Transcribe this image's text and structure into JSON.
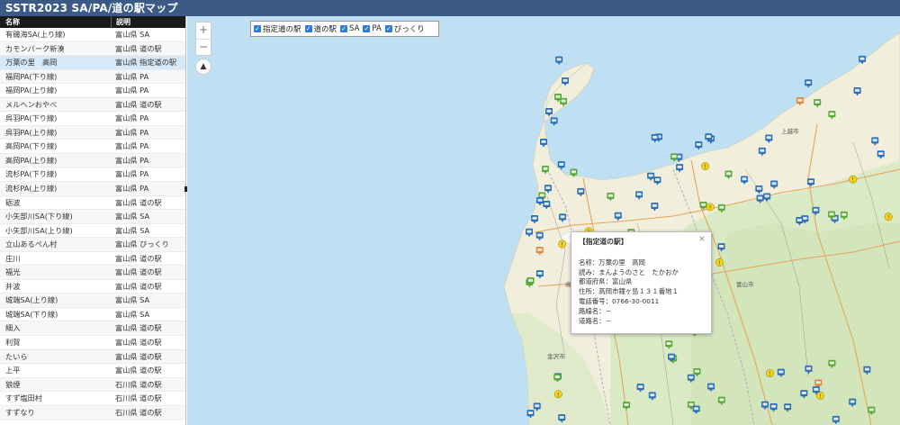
{
  "app": {
    "title": "SSTR2023  SA/PA/道の駅マップ"
  },
  "list": {
    "headers": [
      "名称",
      "説明"
    ],
    "selected_index": 2,
    "rows": [
      {
        "name": "有磯海SA(上り線)",
        "desc": "富山県 SA"
      },
      {
        "name": "カモンパーク新湊",
        "desc": "富山県 道の駅"
      },
      {
        "name": "万葉の里　高岡",
        "desc": "富山県 指定道の駅"
      },
      {
        "name": "福岡PA(下り線)",
        "desc": "富山県 PA"
      },
      {
        "name": "福岡PA(上り線)",
        "desc": "富山県 PA"
      },
      {
        "name": "メルヘンおやべ",
        "desc": "富山県 道の駅"
      },
      {
        "name": "呉羽PA(下り線)",
        "desc": "富山県 PA"
      },
      {
        "name": "呉羽PA(上り線)",
        "desc": "富山県 PA"
      },
      {
        "name": "高岡PA(下り線)",
        "desc": "富山県 PA"
      },
      {
        "name": "高岡PA(上り線)",
        "desc": "富山県 PA"
      },
      {
        "name": "流杉PA(下り線)",
        "desc": "富山県 PA"
      },
      {
        "name": "流杉PA(上り線)",
        "desc": "富山県 PA"
      },
      {
        "name": "砺波",
        "desc": "富山県 道の駅"
      },
      {
        "name": "小矢部川SA(下り線)",
        "desc": "富山県 SA"
      },
      {
        "name": "小矢部川SA(上り線)",
        "desc": "富山県 SA"
      },
      {
        "name": "立山あるぺん村",
        "desc": "富山県 びっくり"
      },
      {
        "name": "庄川",
        "desc": "富山県 道の駅"
      },
      {
        "name": "福光",
        "desc": "富山県 道の駅"
      },
      {
        "name": "井波",
        "desc": "富山県 道の駅"
      },
      {
        "name": "城端SA(上り線)",
        "desc": "富山県 SA"
      },
      {
        "name": "城端SA(下り線)",
        "desc": "富山県 SA"
      },
      {
        "name": "細入",
        "desc": "富山県 道の駅"
      },
      {
        "name": "利賀",
        "desc": "富山県 道の駅"
      },
      {
        "name": "たいら",
        "desc": "富山県 道の駅"
      },
      {
        "name": "上平",
        "desc": "富山県 道の駅"
      },
      {
        "name": "狼煙",
        "desc": "石川県 道の駅"
      },
      {
        "name": "すず塩田村",
        "desc": "石川県 道の駅"
      },
      {
        "name": "すずなり",
        "desc": "石川県 道の駅"
      }
    ]
  },
  "map": {
    "zoom_in": "+",
    "zoom_out": "−",
    "compass": "▲",
    "filters": [
      "指定道の駅",
      "道の駅",
      "SA",
      "PA",
      "びっくり"
    ],
    "check_glyph": "✓",
    "colors": {
      "sea": "#bfe0f3",
      "land": "#f2efe0",
      "road_station": "#2b6fb6",
      "sa": "#5aa83a",
      "pa": "#5aa83a",
      "designated": "#e8823a",
      "surprise": "#f2d21b",
      "header": "#3b5a86"
    },
    "popup": {
      "title": "【指定道の駅】",
      "close": "×",
      "lines": [
        "名称：万葉の里　高岡",
        "読み：まんようのさと　たかおか",
        "都道府県：富山県",
        "住所：高岡市鐘ヶ島１３１番地１",
        "電話番号：0766-30-0011",
        "路線名：－",
        "道路名：－"
      ]
    },
    "place_labels": [
      "上越市",
      "富山市",
      "高岡市",
      "金沢市"
    ]
  }
}
